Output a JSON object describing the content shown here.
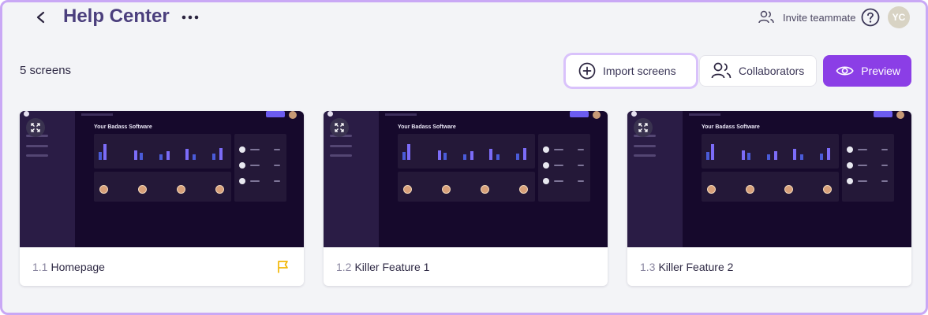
{
  "header": {
    "title": "Help Center",
    "invite_label": "Invite teammate",
    "avatar_initials": "YC"
  },
  "toolbar": {
    "screen_count": "5 screens",
    "import_label": "Import screens",
    "collaborators_label": "Collaborators",
    "preview_label": "Preview"
  },
  "screens": [
    {
      "number": "1.1",
      "name": "Homepage",
      "flagged": true
    },
    {
      "number": "1.2",
      "name": "Killer Feature 1",
      "flagged": false
    },
    {
      "number": "1.3",
      "name": "Killer Feature 2",
      "flagged": false
    }
  ],
  "thumbnail": {
    "app_title": "Your Badass Software"
  },
  "colors": {
    "accent": "#8b3ee6",
    "title": "#4b3f7d",
    "flag": "#f2b705",
    "thumb_bg": "#16092c"
  }
}
